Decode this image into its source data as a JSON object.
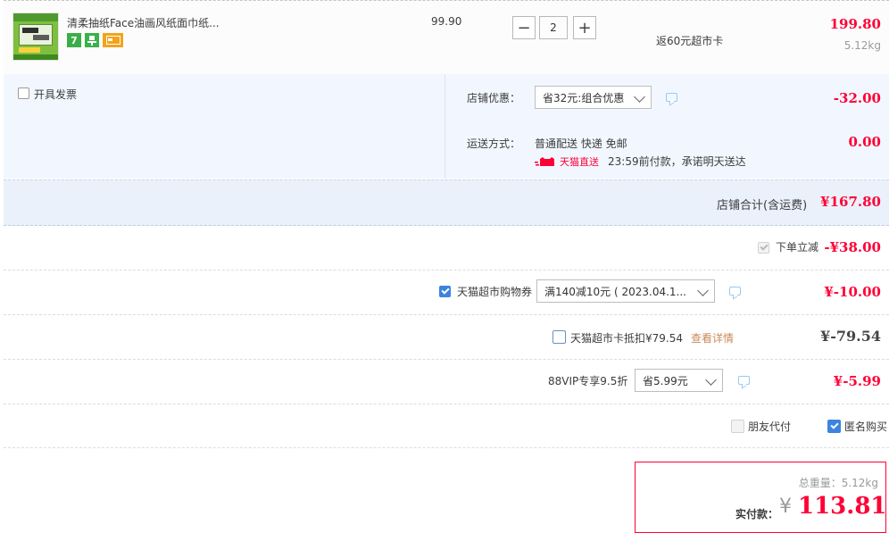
{
  "product": {
    "title": "清柔抽纸Face油画风纸面巾纸...",
    "unit_price": "99.90",
    "quantity": "2",
    "minus_label": "−",
    "plus_label": "+",
    "rebate": "返60元超市卡",
    "subtotal": "199.80",
    "weight": "5.12kg",
    "tags": [
      "7",
      "",
      ""
    ]
  },
  "invoice": {
    "label": "开具发票"
  },
  "shop_discount": {
    "label": "店铺优惠：",
    "selected": "省32元:组合优惠",
    "amount": "-32.00"
  },
  "shipping": {
    "label": "运送方式：",
    "method": "普通配送 快递 免邮",
    "badge": "天猫直送",
    "promise": "23:59前付款，承诺明天送达",
    "amount": "0.00"
  },
  "shop_total": {
    "label": "店铺合计(含运费)",
    "amount": "¥167.80"
  },
  "instant_discount": {
    "label": "下单立减",
    "amount": "-¥38.00"
  },
  "coupon": {
    "label": "天猫超市购物券",
    "selected": "满140减10元 ( 2023.04.1...",
    "amount": "¥-10.00"
  },
  "super_card": {
    "label": "天猫超市卡抵扣¥79.54",
    "link": "查看详情",
    "amount": "¥-79.54"
  },
  "vip": {
    "label": "88VIP专享9.5折",
    "selected": "省5.99元",
    "amount": "¥-5.99"
  },
  "options": {
    "friend_pay": "朋友代付",
    "anonymous": "匿名购买"
  },
  "summary": {
    "weight_label": "总重量：",
    "weight_value": "5.12kg",
    "pay_label": "实付款：",
    "currency": "¥",
    "pay_amount": "113.81"
  },
  "colors": {
    "accent_red": "#ff0036",
    "check_blue": "#3c84e0",
    "shop_bg": "#f2f7ff"
  }
}
